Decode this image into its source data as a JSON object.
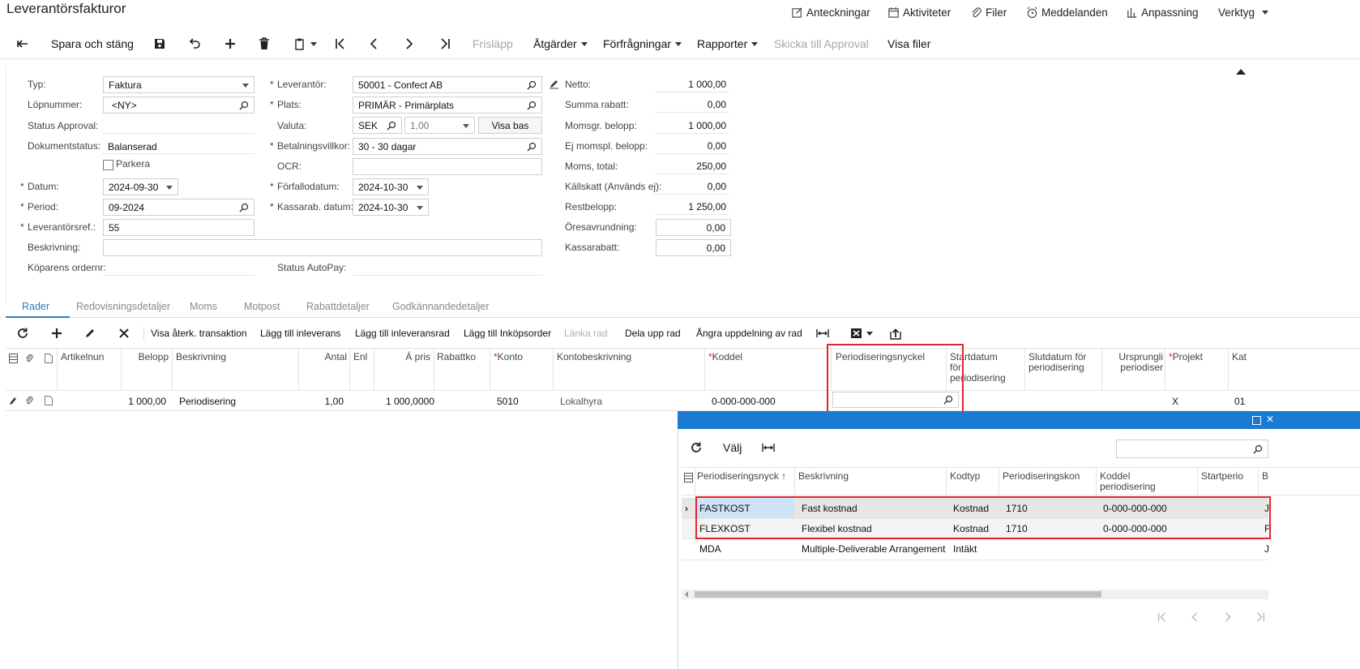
{
  "title": "Leverantörsfakturor",
  "topnav": {
    "notes": "Anteckningar",
    "activities": "Aktiviteter",
    "files": "Filer",
    "messages": "Meddelanden",
    "customization": "Anpassning",
    "tools": "Verktyg"
  },
  "toolbar": {
    "save_close": "Spara och stäng",
    "release": "Frisläpp",
    "actions": "Åtgärder",
    "inquiries": "Förfrågningar",
    "reports": "Rapporter",
    "send_approval": "Skicka till Approval",
    "show_files": "Visa filer"
  },
  "form": {
    "type_label": "Typ:",
    "type_value": "Faktura",
    "refnbr_label": "Löpnummer:",
    "refnbr_value": "<NY>",
    "approval_status_label": "Status Approval:",
    "doc_status_label": "Dokumentstatus:",
    "doc_status_value": "Balanserad",
    "hold_label": "Parkera",
    "date_label": "Datum:",
    "date_value": "2024-09-30",
    "period_label": "Period:",
    "period_value": "09-2024",
    "vendor_ref_label": "Leverantörsref.:",
    "vendor_ref_value": "55",
    "description_label": "Beskrivning:",
    "description_value": "",
    "buyer_order_label": "Köparens ordernr:",
    "vendor_label": "Leverantör:",
    "vendor_value": "50001 - Confect AB",
    "location_label": "Plats:",
    "location_value": "PRIMÄR - Primärplats",
    "currency_label": "Valuta:",
    "currency_value": "SEK",
    "rate_value": "1,00",
    "view_base": "Visa bas",
    "terms_label": "Betalningsvillkor:",
    "terms_value": "30 - 30 dagar",
    "ocr_label": "OCR:",
    "ocr_value": "",
    "due_date_label": "Förfallodatum:",
    "due_date_value": "2024-10-30",
    "cash_disc_date_label": "Kassarab. datum:",
    "cash_disc_date_value": "2024-10-30",
    "autopay_label": "Status AutoPay:",
    "net_label": "Netto:",
    "net_value": "1 000,00",
    "discount_total_label": "Summa rabatt:",
    "discount_total_value": "0,00",
    "taxable_label": "Momsgr. belopp:",
    "taxable_value": "1 000,00",
    "exempt_label": "Ej momspl. belopp:",
    "exempt_value": "0,00",
    "tax_total_label": "Moms, total:",
    "tax_total_value": "250,00",
    "withholding_label": "Källskatt (Används ej):",
    "withholding_value": "0,00",
    "balance_label": "Restbelopp:",
    "balance_value": "1 250,00",
    "rounding_label": "Öresavrundning:",
    "rounding_value": "0,00",
    "cash_discount_label": "Kassarabatt:",
    "cash_discount_value": "0,00"
  },
  "tabs": [
    "Rader",
    "Redovisningsdetaljer",
    "Moms",
    "Motpost",
    "Rabattdetaljer",
    "Godkännandedetaljer"
  ],
  "grid_toolbar": {
    "view_reclass": "Visa återk. transaktion",
    "add_receipt": "Lägg till inleverans",
    "add_receipt_line": "Lägg till inleveransrad",
    "add_po": "Lägg till Inköpsorder",
    "link_line": "Länka rad",
    "split_line": "Dela upp rad",
    "undo_split": "Ångra uppdelning av rad"
  },
  "grid": {
    "headers": {
      "item": "Artikelnun",
      "amount": "Belopp",
      "desc": "Beskrivning",
      "qty": "Antal",
      "uom": "Enl",
      "unit_price": "Á pris",
      "discount": "Rabattko",
      "account": "Konto",
      "account_desc": "Kontobeskrivning",
      "subaccount": "Koddel",
      "deferral_code": "Periodiseringsnyckel",
      "start_l1": "Startdatum",
      "start_l2": "för",
      "start_l3": "periodisering",
      "end_l1": "Slutdatum för",
      "end_l2": "periodisering",
      "orig_l1": "Ursprungli",
      "orig_l2": "periodiser",
      "project": "Projekt",
      "kat": "Kat"
    },
    "row": {
      "amount": "1 000,00",
      "desc": "Periodisering",
      "qty": "1,00",
      "unit_price": "1 000,0000",
      "account": "5010",
      "account_desc": "Lokalhyra",
      "subaccount": "0-000-000-000",
      "deferral_code": "",
      "project": "X",
      "kat": "01"
    }
  },
  "lookup": {
    "select": "Välj",
    "search_value": "",
    "headers": {
      "code": "Periodiseringsnyck",
      "desc": "Beskrivning",
      "type": "Kodtyp",
      "acct": "Periodiseringskon",
      "sub_l1": "Koddel",
      "sub_l2": "periodisering",
      "start": "Startperio",
      "b": "B"
    },
    "rows": [
      {
        "code": "FASTKOST",
        "desc": "Fast kostnad",
        "type": "Kostnad",
        "acct": "1710",
        "sub": "0-000-000-000",
        "extra": "J"
      },
      {
        "code": "FLEXKOST",
        "desc": "Flexibel kostnad",
        "type": "Kostnad",
        "acct": "1710",
        "sub": "0-000-000-000",
        "extra": "F"
      },
      {
        "code": "MDA",
        "desc": "Multiple-Deliverable Arrangement",
        "type": "Intäkt",
        "acct": "",
        "sub": "",
        "extra": "J"
      }
    ]
  },
  "colors": {
    "accent": "#2f7bbf",
    "lookup_bar": "#1b7bd3",
    "highlight": "#e3262b",
    "selected_cell": "#cfe3f7"
  }
}
